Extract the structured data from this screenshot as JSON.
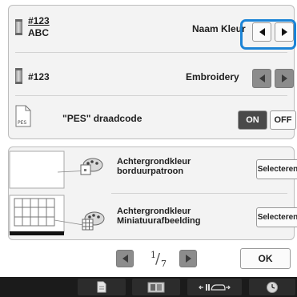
{
  "colors": {
    "highlight": "#1c84d6",
    "bottom_bar": "#1b1b1b",
    "panel": "#f3f3f3",
    "on_toggle": "#4a4a4a"
  },
  "settings": {
    "color_name": {
      "code": "#123",
      "name": "ABC",
      "label": "Naam Kleur"
    },
    "thread_number": {
      "code": "#123",
      "label": "Embroidery"
    },
    "pes": {
      "file_label": "PES",
      "label": "\"PES\" draadcode",
      "on": "ON",
      "off": "OFF",
      "state": "ON"
    }
  },
  "background": {
    "pattern": {
      "label_line1": "Achtergrondkleur",
      "label_line2": "borduurpatroon",
      "button": "Selecteren",
      "icon": "embroidery-pattern-preview-icon"
    },
    "thumbnail": {
      "label_line1": "Achtergrondkleur",
      "label_line2": "Miniatuurafbeelding",
      "button": "Selecteren",
      "icon": "thumbnail-grid-icon"
    }
  },
  "pager": {
    "current": "1",
    "total": "7"
  },
  "ok_label": "OK",
  "bottom_bar": {
    "icons": [
      "page-icon",
      "image-preview-icon",
      "machine-presser-icon",
      "clock-icon"
    ]
  }
}
